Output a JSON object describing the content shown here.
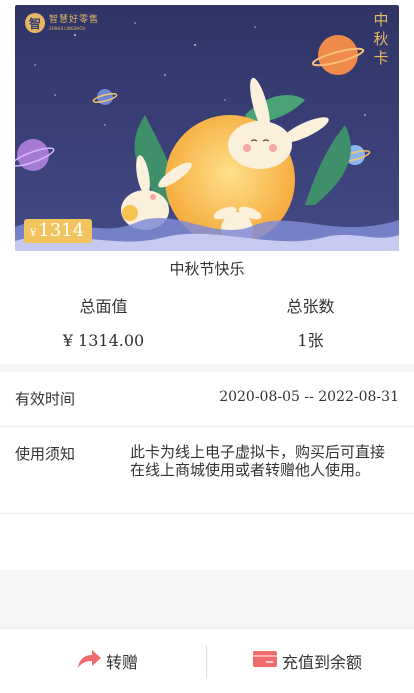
{
  "card": {
    "logo_cn": "智慧好零售",
    "logo_en": "ZHIHUI LINGSHOU",
    "vertical_title": [
      "中",
      "秋",
      "卡"
    ],
    "badge_currency": "¥",
    "badge_amount": "1314"
  },
  "card_name": "中秋节快乐",
  "stats": {
    "total_value_label": "总面值",
    "total_value": "¥ 1314.00",
    "total_count_label": "总张数",
    "total_count": "1张"
  },
  "validity": {
    "label": "有效时间",
    "value": "2020-08-05 -- 2022-08-31"
  },
  "notice": {
    "label": "使用须知",
    "value": "此卡为线上电子虚拟卡，购买后可直接在线上商城使用或者转赠他人使用。"
  },
  "actions": {
    "gift_label": "转赠",
    "gift_icon": "share-arrow-icon",
    "recharge_label": "充值到余额",
    "recharge_icon": "card-icon"
  },
  "colors": {
    "card_bg": "#3a3f6e",
    "gold": "#e7b762",
    "badge": "#f1c45e",
    "accent": "#f06b6b"
  }
}
